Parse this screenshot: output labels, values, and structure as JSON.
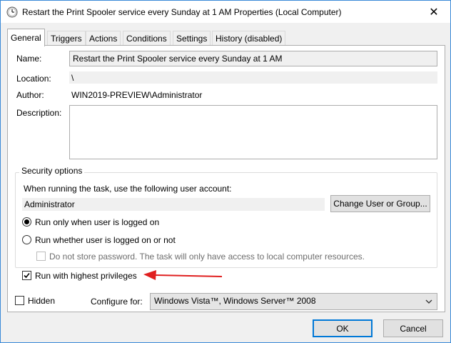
{
  "window": {
    "title": "Restart the Print Spooler service every Sunday at 1 AM Properties (Local Computer)",
    "close_glyph": "✕"
  },
  "tabs": [
    {
      "label": "General",
      "active": true
    },
    {
      "label": "Triggers",
      "active": false
    },
    {
      "label": "Actions",
      "active": false
    },
    {
      "label": "Conditions",
      "active": false
    },
    {
      "label": "Settings",
      "active": false
    },
    {
      "label": "History (disabled)",
      "active": false
    }
  ],
  "general": {
    "name_label": "Name:",
    "name_value": "Restart the Print Spooler service every Sunday at 1 AM",
    "location_label": "Location:",
    "location_value": "\\",
    "author_label": "Author:",
    "author_value": "WIN2019-PREVIEW\\Administrator",
    "description_label": "Description:",
    "description_value": ""
  },
  "security": {
    "group_title": "Security options",
    "account_prompt": "When running the task, use the following user account:",
    "account_value": "Administrator",
    "change_button": "Change User or Group...",
    "radio_logged_on": "Run only when user is logged on",
    "radio_whether": "Run whether user is logged on or not",
    "no_store_password": "Do not store password.  The task will only have access to local computer resources.",
    "highest_privileges": "Run with highest privileges",
    "radio_logged_on_checked": true,
    "highest_privileges_checked": true
  },
  "bottom": {
    "hidden_label": "Hidden",
    "configure_label": "Configure for:",
    "configure_value": "Windows Vista™, Windows Server™ 2008",
    "ok_label": "OK",
    "cancel_label": "Cancel"
  },
  "colors": {
    "accent": "#0078d7",
    "annotation_arrow": "#e02020"
  },
  "icons": {
    "title": "clock-icon",
    "annotation": "red-arrow-icon"
  }
}
